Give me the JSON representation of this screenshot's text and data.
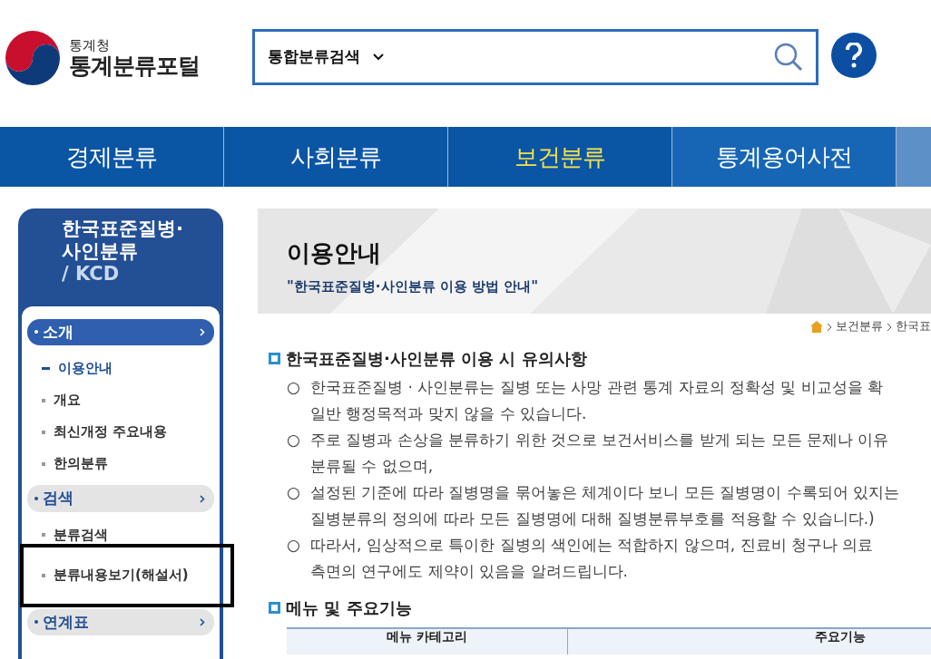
{
  "header": {
    "agency": "통계청",
    "portal": "통계분류포털",
    "search": {
      "scope": "통합분류검색"
    }
  },
  "nav": [
    {
      "label": "경제분류",
      "selected": false
    },
    {
      "label": "사회분류",
      "selected": false
    },
    {
      "label": "보건분류",
      "selected": true
    },
    {
      "label": "통계용어사전",
      "selected": false
    }
  ],
  "sidebar": {
    "title_lines": [
      "한국표준질병·",
      "사인분류",
      "/ KCD"
    ],
    "sections": [
      {
        "label": "소개",
        "selected": true,
        "items": [
          {
            "label": "이용안내",
            "selected": true
          },
          {
            "label": "개요",
            "selected": false
          },
          {
            "label": "최신개정 주요내용",
            "selected": false
          },
          {
            "label": "한의분류",
            "selected": false
          }
        ]
      },
      {
        "label": "검색",
        "selected": false,
        "items": [
          {
            "label": "분류검색",
            "selected": false
          },
          {
            "label": "분류내용보기(해설서)",
            "selected": false,
            "highlighted": true
          }
        ]
      },
      {
        "label": "연계표",
        "selected": false
      }
    ]
  },
  "page": {
    "title": "이용안내",
    "subtitle": "\"한국표준질병·사인분류 이용 방법 안내\"",
    "breadcrumb": [
      "보건분류",
      "한국표"
    ],
    "notice": {
      "heading": "한국표준질병·사인분류 이용 시 유의사항",
      "items": [
        {
          "marker": "○",
          "lines": [
            "한국표준질병 · 사인분류는 질병 또는 사망 관련 통계 자료의 정확성 및 비교성을 확",
            "일반 행정목적과 맞지 않을 수 있습니다."
          ]
        },
        {
          "marker": "○",
          "lines": [
            "주로 질병과 손상을 분류하기 위한 것으로 보건서비스를 받게 되는 모든 문제나 이유",
            "분류될 수 없으며,"
          ]
        },
        {
          "marker": "○",
          "lines": [
            "설정된 기준에 따라 질병명을 묶어놓은 체계이다 보니 모든 질병명이 수록되어 있지는",
            "질병분류의 정의에 따라 모든 질병명에 대해 질병분류부호를 적용할 수 있습니다.)"
          ]
        },
        {
          "marker": "○",
          "lines": [
            "따라서, 임상적으로 특이한 질병의 색인에는 적합하지 않으며, 진료비 청구나 의료",
            "측면의 연구에도 제약이 있음을 알려드립니다."
          ]
        }
      ]
    },
    "menu": {
      "heading": "메뉴 및 주요기능",
      "columns": [
        "메뉴 카테고리",
        "주요기능"
      ]
    }
  }
}
